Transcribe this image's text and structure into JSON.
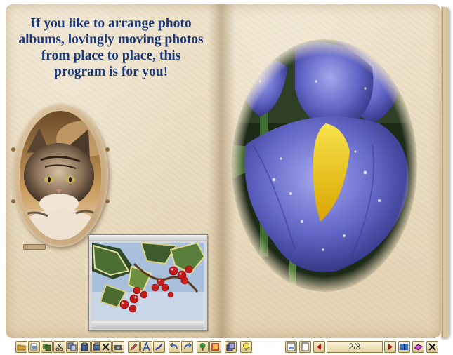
{
  "album": {
    "headline": "If you like to arrange photo albums, lovingly moving photos from place to place, this program is for you!",
    "photos": [
      {
        "subject": "tabby cat portrait",
        "frame": "oval wooden frame"
      },
      {
        "subject": "holly branch with red berries",
        "frame": "window frame"
      },
      {
        "subject": "blue iris flower with yellow blotch",
        "frame": "oval vignette"
      }
    ]
  },
  "toolbar": {
    "left_icons": [
      "open-folder-icon",
      "new-page-icon",
      "save-icon",
      "cut-icon",
      "copy-icon",
      "paste-icon",
      "delete-icon",
      "camera-icon",
      "pencil-icon",
      "text-icon",
      "brush-icon",
      "undo-icon",
      "redo-icon",
      "tree-icon",
      "effects-icon",
      "layers-icon",
      "bulb-icon"
    ],
    "right_icons": [
      "page-layout-icon",
      "blank-page-icon",
      "prev-page-icon",
      "next-page-icon",
      "book-icon",
      "eraser-icon",
      "close-icon"
    ],
    "page_counter": "2/3"
  },
  "colors": {
    "headline": "#1c3878",
    "paper": "#ecdfc4",
    "toolbar_button": "#e9d7a4"
  }
}
